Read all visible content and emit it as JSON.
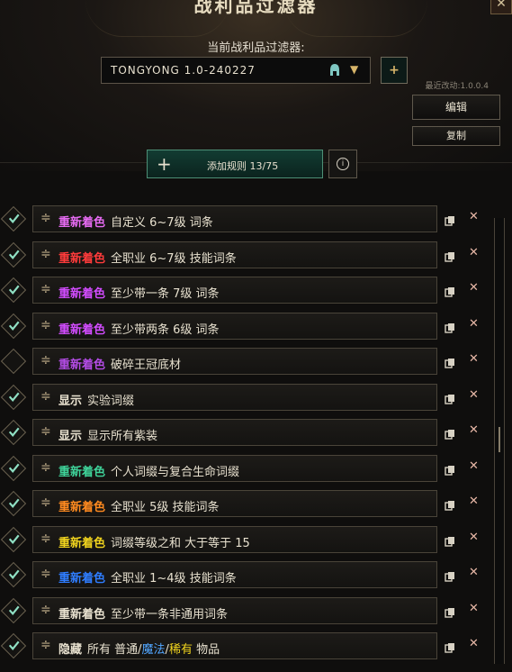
{
  "window": {
    "title": "战利品过滤器"
  },
  "filter": {
    "label": "当前战利品过滤器:",
    "selected": "TONGYONG 1.0-240227",
    "last_modified": "最近改动:1.0.0.4"
  },
  "buttons": {
    "edit": "编辑",
    "copy": "复制",
    "add_rule": "添加规则 13/75",
    "close": "✕",
    "plus": "+",
    "info": "i"
  },
  "rules": [
    {
      "enabled": true,
      "action": "重新着色",
      "color": "#e66bf2",
      "desc": "自定义 6~7级 词条"
    },
    {
      "enabled": true,
      "action": "重新着色",
      "color": "#ff3b3b",
      "desc": "全职业 6~7级 技能词条"
    },
    {
      "enabled": true,
      "action": "重新着色",
      "color": "#d24cff",
      "desc": "至少带一条 7级 词条"
    },
    {
      "enabled": true,
      "action": "重新着色",
      "color": "#d24cff",
      "desc": "至少带两条 6级 词条"
    },
    {
      "enabled": false,
      "action": "重新着色",
      "color": "#b34ce5",
      "desc": "破碎王冠底材"
    },
    {
      "enabled": true,
      "action": "显示",
      "color": "#e8e1cf",
      "desc": "实验词缀"
    },
    {
      "enabled": true,
      "action": "显示",
      "color": "#e8e1cf",
      "desc": "显示所有紫装"
    },
    {
      "enabled": true,
      "action": "重新着色",
      "color": "#3fd39a",
      "desc": "个人词缀与复合生命词缀"
    },
    {
      "enabled": true,
      "action": "重新着色",
      "color": "#ff8a1f",
      "desc": "全职业 5级 技能词条"
    },
    {
      "enabled": true,
      "action": "重新着色",
      "color": "#f0d31e",
      "desc": "词缀等级之和 大于等于 15"
    },
    {
      "enabled": true,
      "action": "重新着色",
      "color": "#2f7dff",
      "desc": "全职业 1~4级 技能词条"
    },
    {
      "enabled": true,
      "action": "重新着色",
      "color": "#e8e1cf",
      "desc": "至少带一条非通用词条"
    },
    {
      "enabled": true,
      "action": "隐藏",
      "color": "#e8e1cf",
      "desc_parts": [
        {
          "t": "所有 普通/",
          "c": "#e8e1cf"
        },
        {
          "t": "魔法",
          "c": "#52a6ff"
        },
        {
          "t": "/",
          "c": "#e8e1cf"
        },
        {
          "t": "稀有",
          "c": "#f0d31e"
        },
        {
          "t": " 物品",
          "c": "#e8e1cf"
        }
      ]
    }
  ]
}
